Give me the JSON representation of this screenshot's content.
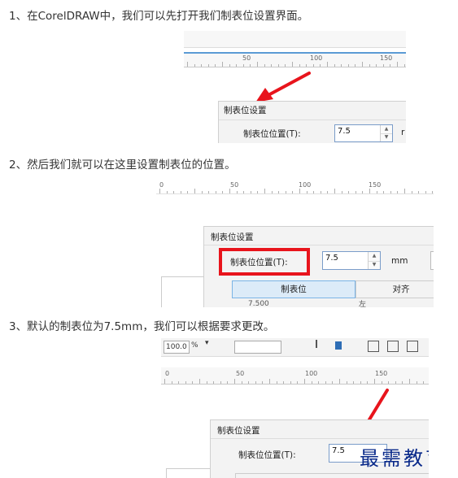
{
  "steps": [
    "1、在CorelDRAW中，我们可以先打开我们制表位设置界面。",
    "2、然后我们就可以在这里设置制表位的位置。",
    "3、默认的制表位为7.5mm，我们可以根据要求更改。"
  ],
  "shot1": {
    "ruler_numbers": [
      "50",
      "100",
      "150"
    ],
    "panel_title": "制表位设置",
    "position_label": "制表位位置(T):",
    "position_value": "7.5",
    "unit_fragment": "r"
  },
  "shot2": {
    "ruler_numbers": [
      "0",
      "50",
      "100",
      "150"
    ],
    "panel_title": "制表位设置",
    "position_label": "制表位位置(T):",
    "position_value": "7.5",
    "unit": "mm",
    "tab_labels": [
      "制表位",
      "对齐"
    ],
    "row_value": "7.500",
    "row_align": "左"
  },
  "shot3": {
    "zoom_value": "100.0",
    "zoom_unit": "%",
    "ruler_numbers": [
      "0",
      "50",
      "100",
      "150"
    ],
    "panel_title": "制表位设置",
    "position_label": "制表位位置(T):",
    "position_value": "7.5"
  },
  "watermark": "最需教育",
  "colors": {
    "highlight_red": "#e8141c",
    "selected_tab": "#dcebf8",
    "ruler_accent": "#5b9bd5"
  }
}
